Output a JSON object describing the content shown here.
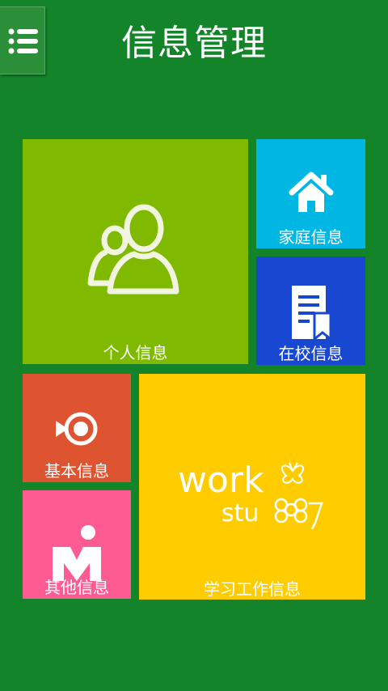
{
  "header": {
    "title": "信息管理"
  },
  "colors": {
    "background": "#13842a",
    "personal": "#7fb900",
    "family": "#00b7e3",
    "school": "#1848d2",
    "basic": "#df5430",
    "other": "#fe5b92",
    "study": "#ffcc00"
  },
  "tiles": {
    "personal": {
      "label": "个人信息",
      "icon": "users-icon"
    },
    "family": {
      "label": "家庭信息",
      "icon": "home-icon"
    },
    "school": {
      "label": "在校信息",
      "icon": "document-bookmark-icon"
    },
    "basic": {
      "label": "基本信息",
      "icon": "target-arrow-icon"
    },
    "other": {
      "label": "其他信息",
      "icon": "user-m-icon"
    },
    "study": {
      "label": "学习工作信息",
      "icon": "work-study-logo",
      "logo_text": {
        "line1": "work",
        "line2": "stu"
      }
    }
  }
}
